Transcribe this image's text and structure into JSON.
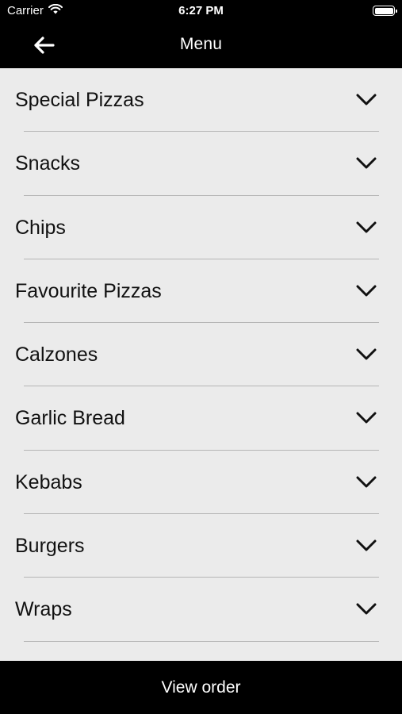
{
  "status_bar": {
    "carrier": "Carrier",
    "time": "6:27 PM",
    "wifi_icon": "wifi-icon",
    "battery_icon": "battery-icon"
  },
  "nav": {
    "title": "Menu",
    "back_icon": "arrow-left-icon"
  },
  "menu": {
    "items": [
      {
        "label": "Special Pizzas"
      },
      {
        "label": "Snacks"
      },
      {
        "label": "Chips"
      },
      {
        "label": "Favourite Pizzas"
      },
      {
        "label": "Calzones"
      },
      {
        "label": "Garlic Bread"
      },
      {
        "label": "Kebabs"
      },
      {
        "label": "Burgers"
      },
      {
        "label": "Wraps"
      }
    ],
    "chevron_icon": "chevron-down-icon"
  },
  "bottom_bar": {
    "label": "View order"
  },
  "colors": {
    "bars": "#000000",
    "list_background": "#ebebeb",
    "divider": "#b5b5b5",
    "text_dark": "#111111",
    "text_light": "#ffffff"
  }
}
